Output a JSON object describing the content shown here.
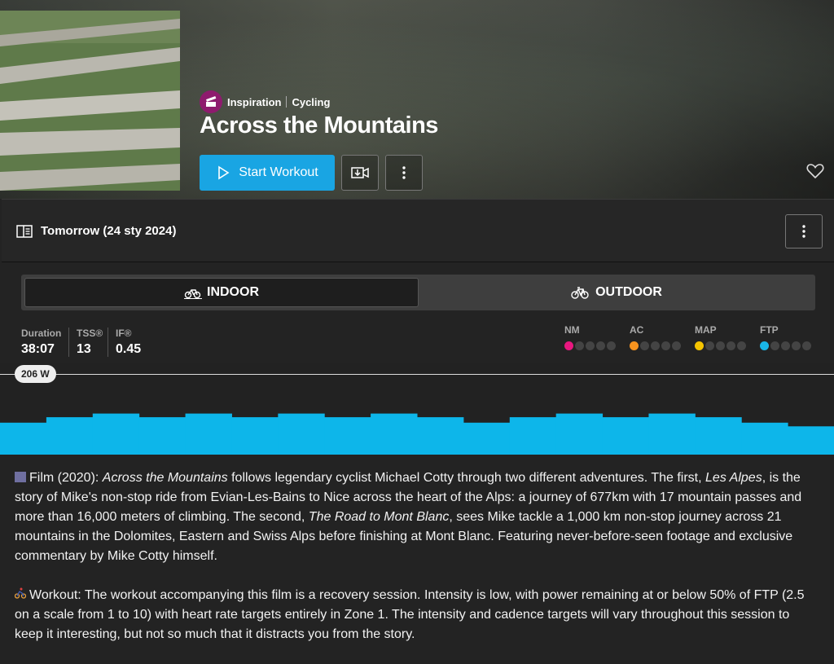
{
  "header": {
    "category": "Inspiration",
    "sport": "Cycling",
    "title": "Across the Mountains",
    "start_label": "Start Workout"
  },
  "schedule": {
    "label": "Tomorrow (24 sty 2024)"
  },
  "mode_toggle": {
    "indoor_label": "INDOOR",
    "outdoor_label": "OUTDOOR",
    "selected": "INDOOR"
  },
  "stats": {
    "duration_label": "Duration",
    "duration_value": "38:07",
    "tss_label": "TSS®",
    "tss_value": "13",
    "if_label": "IF®",
    "if_value": "0.45"
  },
  "ratings": [
    {
      "label": "NM",
      "level": 1,
      "color": "#e8177f"
    },
    {
      "label": "AC",
      "level": 1,
      "color": "#f7931e"
    },
    {
      "label": "MAP",
      "level": 1,
      "color": "#f5c400"
    },
    {
      "label": "FTP",
      "level": 1,
      "color": "#19b6e8"
    }
  ],
  "profile": {
    "ftp_badge": "206 W",
    "bar_color": "#0db6ea",
    "segment_levels": [
      0.35,
      0.41,
      0.45,
      0.41,
      0.45,
      0.41,
      0.45,
      0.41,
      0.45,
      0.41,
      0.35,
      0.41,
      0.45,
      0.41,
      0.45,
      0.41,
      0.35,
      0.31
    ]
  },
  "description": {
    "p1_prefix": "Film (2020): ",
    "p1_title": "Across the Mountains",
    "p1_a": " follows legendary cyclist Michael Cotty through two different adventures. The first, ",
    "p1_title2": "Les Alpes",
    "p1_b": ", is the story of Mike's non-stop ride from Evian-Les-Bains to Nice across the heart of the Alps: a journey of 677km with 17 mountain passes and more than 16,000 meters of climbing. The second, ",
    "p1_title3": "The Road to Mont Blanc",
    "p1_c": ", sees Mike tackle a 1,000 km non-stop journey across 21 mountains in the Dolomites, Eastern and Swiss Alps before finishing at Mont Blanc. Featuring never-before-seen footage and exclusive commentary by Mike Cotty himself.",
    "p2": "Workout: The workout accompanying this film is a recovery session. Intensity is low, with power remaining at or below 50% of FTP (2.5 on a scale from 1 to 10) with heart rate targets entirely in Zone 1. The intensity and cadence targets will vary throughout this session to keep it interesting, but not so much that it distracts you from the story."
  }
}
